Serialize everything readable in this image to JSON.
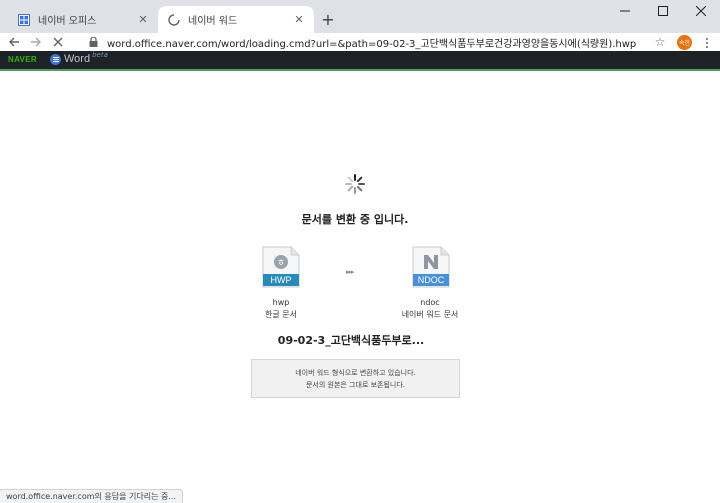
{
  "browser": {
    "tabs": [
      {
        "title": "네이버 오피스",
        "icon": "office-grid-icon"
      },
      {
        "title": "네이버 워드",
        "icon": "loading-spinner-icon"
      }
    ],
    "new_tab": "+",
    "url_host": "word.office.naver.com",
    "url_path": "/word/loading.cmd?url=&path=09-02-3_고단백식품두부로건강과영양을동시에(식량원).hwp",
    "profile_initials": "속한"
  },
  "appbar": {
    "naver_logo": "NAVER",
    "word_label": "Word",
    "word_beta": "beta"
  },
  "main": {
    "heading": "문서를 변환 중 입니다.",
    "source": {
      "badge": "HWP",
      "name": "hwp",
      "desc": "한글 문서"
    },
    "target": {
      "badge": "NDOC",
      "name": "ndoc",
      "desc": "네이버 워드 문서"
    },
    "arrows": "▸▸▸",
    "filename": "09-02-3_고단백식품두부로...",
    "notice_line1": "네이버 워드 형식으로 변환하고 있습니다.",
    "notice_line2": "문서의 원본은 그대로 보존됩니다."
  },
  "status_text": "word.office.naver.com의 응답을 기다리는 중...",
  "colors": {
    "hwp_badge": "#2a8ab7",
    "ndoc_badge": "#4a90d9",
    "naver_green": "#2db400",
    "appbar_bg": "#1e2227"
  }
}
